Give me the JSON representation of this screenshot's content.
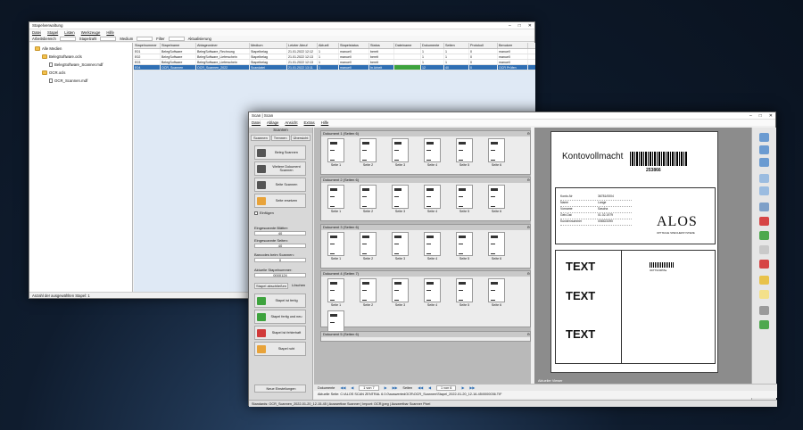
{
  "back_window": {
    "title": "Stapelverwaltung",
    "menu": [
      "Datei",
      "Stapel",
      "Listen",
      "Werkzeuge",
      "Hilfe"
    ],
    "toolbar": [
      "Arbeitsbereich",
      "Stapelzahl",
      "Medium",
      "Filter",
      "Aktualisierung"
    ],
    "tree": [
      "Alle Medien",
      "BelegSoftware.ocls",
      "BelegSoftware_Scanner.mdf",
      "OCR.ocls",
      "OCR_Scannen.mdf"
    ],
    "columns": [
      "Stapelnummer",
      "Stapelname",
      "Ablageordner",
      "Medium",
      "Letzter Abruf",
      "Aktuell",
      "Stapelstatus",
      "Status",
      "Dateiname",
      "Dokumente",
      "Seiten",
      "Protokoll",
      "Benutzer"
    ],
    "rows": [
      [
        "E01",
        "BelegSoftware",
        "BelegSoftware_Rechnung",
        "Stapelbelag",
        "21.01.2022 12:12",
        "1",
        "manuell",
        "bereit",
        "",
        "1",
        "1",
        "0",
        "manuell"
      ],
      [
        "E02",
        "BelegSoftware",
        "BelegSoftware_Lieferschein",
        "Stapelbelag",
        "21.01.2022 12:13",
        "1",
        "manuell",
        "bereit",
        "",
        "1",
        "1",
        "0",
        "manuell"
      ],
      [
        "E03",
        "BelegSoftware",
        "BelegSoftware_Lieferschein",
        "Stapelbelag",
        "21.01.2022 12:13",
        "1",
        "manuell",
        "bereit",
        "",
        "1",
        "1",
        "0",
        "manuell"
      ],
      [
        "E04",
        "OCR_Scannen",
        "OCR_Scannen_2022",
        "Scandatei",
        "21.01.2022 13:11",
        "1",
        "manuell",
        "In Arbeit",
        "",
        "12",
        "40",
        "0",
        "OCR Prüfen"
      ]
    ],
    "status": "Anzahl der ausgewählten Stapel: 1"
  },
  "front_window": {
    "title": "Scan | Scan",
    "menu": [
      "Datei",
      "Ablage",
      "Ansicht",
      "Extras",
      "Hilfe"
    ],
    "filter_label": "Filter",
    "filter_value": "Mediasteine",
    "left_header": "Scannen",
    "tabs": [
      "Scannen",
      "Trennen",
      "Übersicht"
    ],
    "buttons": [
      "Beleg Scannen",
      "Weitere Dokument Scannen",
      "Seite Scannen",
      "Seite ersetzen"
    ],
    "duplex_label": "Einfügen",
    "fields": [
      {
        "label": "Eingescannte Blätter:",
        "value": "40"
      },
      {
        "label": "Eingescannte Seiten:",
        "value": "40"
      },
      {
        "label": "Barcodes beim Scannen:",
        "value": "0"
      },
      {
        "label": "Aktuelle Stapelnummer:",
        "value": "0000124"
      }
    ],
    "section_tabs": [
      "Stapel abschließen",
      "Löschen"
    ],
    "close_buttons": [
      "Stapel ist fertig",
      "Stapel fertig und neu",
      "Stapel ist fehlerhaft",
      "Stapel ruht"
    ],
    "bottom_btn": "Neue Einstellungen",
    "groups": [
      {
        "name": "Dokument 1 (Seiten 6)",
        "pages": [
          "Seite 1",
          "Seite 2",
          "Seite 3",
          "Seite 4",
          "Seite 5",
          "Seite 6"
        ]
      },
      {
        "name": "Dokument 2 (Seiten 6)",
        "pages": [
          "Seite 1",
          "Seite 2",
          "Seite 3",
          "Seite 4",
          "Seite 5",
          "Seite 6"
        ]
      },
      {
        "name": "Dokument 3 (Seiten 6)",
        "pages": [
          "Seite 1",
          "Seite 2",
          "Seite 3",
          "Seite 4",
          "Seite 5",
          "Seite 6"
        ]
      },
      {
        "name": "Dokument 4 (Seiten 7)",
        "pages": [
          "Seite 1",
          "Seite 2",
          "Seite 3",
          "Seite 4",
          "Seite 5",
          "Seite 6",
          "Seite 7"
        ]
      },
      {
        "name": "Dokument 5 (Seiten 6)",
        "pages": []
      }
    ],
    "nav": {
      "doc_label": "Dokumente",
      "doc_value": "1 von 7",
      "page_label": "Seiten",
      "page_value": "1 von 6"
    },
    "path": "Aktuelle Seite: C:\\ALOS SCAN ZENTRAL 6.0.0\\auswertedOCR\\OCR_Scannen\\Stapel_2022-01-20_12-16-45\\0000036.TIF",
    "viewer_status": "Aktueller Viewer",
    "status": "Standards: OCR_Scannen_2022-01-20_12-15-45 | Auswertbar Scanner | Import: OCR.jpeg | Auswertbar Scanner Pixel"
  },
  "document": {
    "title": "Kontovollmacht",
    "barcode_number": "253866",
    "fields": [
      [
        "Konto-Nr",
        "36781/0004"
      ],
      [
        "Name",
        "Lange"
      ],
      [
        "Vorname",
        "Sascha"
      ],
      [
        "Geb.Dat",
        "01.02.1979"
      ],
      [
        "Kundennummer",
        "006523390"
      ]
    ],
    "logo": "ALOS",
    "logo_sub": "OPTISCHE SPEICHERSYSTEME",
    "text1": "TEXT",
    "text2": "TEXT",
    "text3": "TEXT",
    "small_barcode": "3DTT020055a"
  }
}
